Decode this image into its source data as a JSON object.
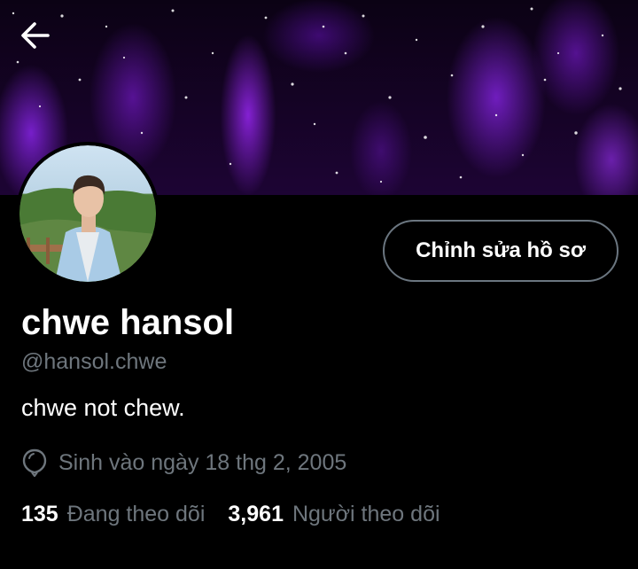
{
  "colors": {
    "background": "#000000",
    "text_primary": "#ffffff",
    "text_secondary": "#6e767d",
    "banner_accent": "#9b2cff",
    "button_border": "#6b7680"
  },
  "header": {
    "back_icon": "arrow-left-icon"
  },
  "profile": {
    "edit_button_label": "Chỉnh sửa hồ sơ",
    "display_name": "chwe hansol",
    "handle": "@hansol.chwe",
    "bio": "chwe not chew.",
    "birthday_icon": "balloon-icon",
    "birthday_text": "Sinh vào ngày 18 thg 2, 2005",
    "following_count": "135",
    "following_label": "Đang theo dõi",
    "followers_count": "3,961",
    "followers_label": "Người theo dõi"
  }
}
